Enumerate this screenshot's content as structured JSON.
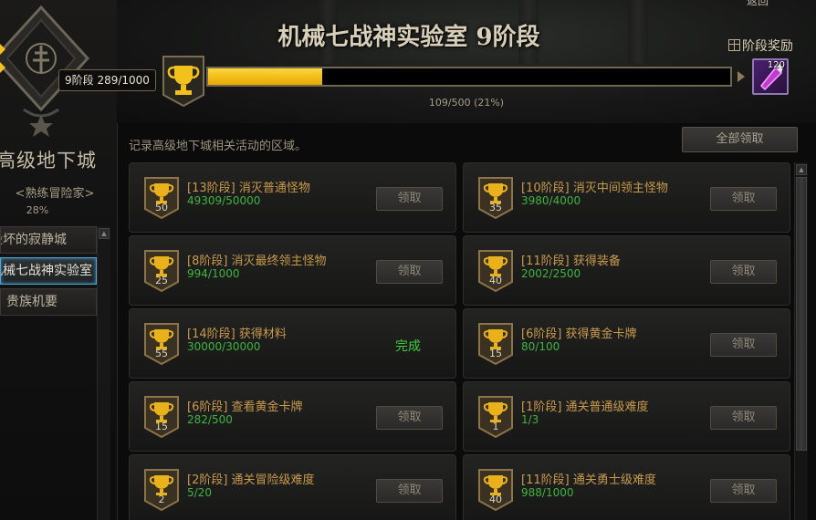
{
  "dungeon": {
    "title": "高级地下城",
    "subtitle": "<熟练冒险家>",
    "percent": "28%"
  },
  "sidebar": {
    "items": [
      {
        "label": "毁坏的寂静城",
        "active": false
      },
      {
        "label": "机械七战神实验室",
        "active": true
      },
      {
        "label": "贵族机要",
        "active": false
      }
    ]
  },
  "header": {
    "title": "机械七战神实验室 9阶段",
    "back_label": "返回",
    "stage_reward_label": "阶段奖励",
    "level_badge": "9阶段  289/1000",
    "progress_text": "109/500 (21%)",
    "progress_fraction": 0.218,
    "reward_qty": "120"
  },
  "description": "记录高级地下城相关活动的区域。",
  "claim_all_label": "全部领取",
  "claim_label": "领取",
  "done_label": "完成",
  "colors": {
    "accent_gold": "#f2c11c",
    "progress_green": "#3fb43f",
    "title_orange": "#c99a4c",
    "selected_blue": "#4aa7d6"
  },
  "quests": [
    {
      "stage": "50",
      "title": "[13阶段] 消灭普通怪物",
      "progress": "49309/50000",
      "done": false
    },
    {
      "stage": "35",
      "title": "[10阶段] 消灭中间领主怪物",
      "progress": "3980/4000",
      "done": false
    },
    {
      "stage": "25",
      "title": "[8阶段] 消灭最终领主怪物",
      "progress": "994/1000",
      "done": false
    },
    {
      "stage": "40",
      "title": "[11阶段] 获得装备",
      "progress": "2002/2500",
      "done": false
    },
    {
      "stage": "55",
      "title": "[14阶段] 获得材料",
      "progress": "30000/30000",
      "done": true
    },
    {
      "stage": "15",
      "title": "[6阶段] 获得黄金卡牌",
      "progress": "80/100",
      "done": false
    },
    {
      "stage": "15",
      "title": "[6阶段] 查看黄金卡牌",
      "progress": "282/500",
      "done": false
    },
    {
      "stage": "1",
      "title": "[1阶段] 通关普通级难度",
      "progress": "1/3",
      "done": false
    },
    {
      "stage": "2",
      "title": "[2阶段] 通关冒险级难度",
      "progress": "5/20",
      "done": false
    },
    {
      "stage": "40",
      "title": "[11阶段] 通关勇士级难度",
      "progress": "988/1000",
      "done": false
    }
  ]
}
